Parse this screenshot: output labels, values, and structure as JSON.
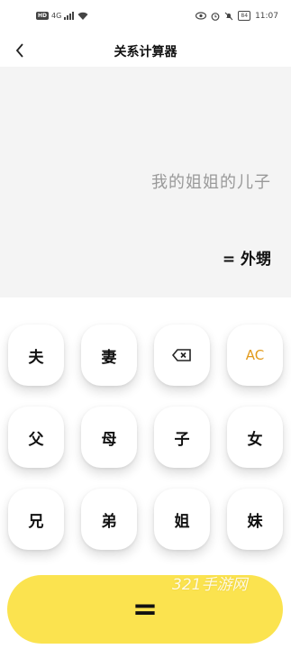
{
  "status_bar": {
    "left_badge": "HD",
    "network": "4G",
    "battery": "84",
    "time": "11:07",
    "icons": [
      "signal-icon",
      "wifi-icon",
      "eye-icon",
      "alarm-icon",
      "bell-mute-icon",
      "battery-icon"
    ]
  },
  "header": {
    "title": "关系计算器",
    "back_icon": "chevron-left-icon"
  },
  "display": {
    "expression": "我的姐姐的儿子",
    "result": "= 外甥"
  },
  "keypad": {
    "row1": [
      "夫",
      "妻",
      "backspace",
      "AC"
    ],
    "row2": [
      "父",
      "母",
      "子",
      "女"
    ],
    "row3": [
      "兄",
      "弟",
      "姐",
      "妹"
    ],
    "keys": {
      "husband": "夫",
      "wife": "妻",
      "clear": "AC",
      "father": "父",
      "mother": "母",
      "son": "子",
      "daughter": "女",
      "elder_brother": "兄",
      "younger_brother": "弟",
      "elder_sister": "姐",
      "younger_sister": "妹"
    },
    "equals": "=",
    "accent_color": "#fbe34f",
    "ac_color": "#e29a1b"
  },
  "watermark": "321手游网"
}
